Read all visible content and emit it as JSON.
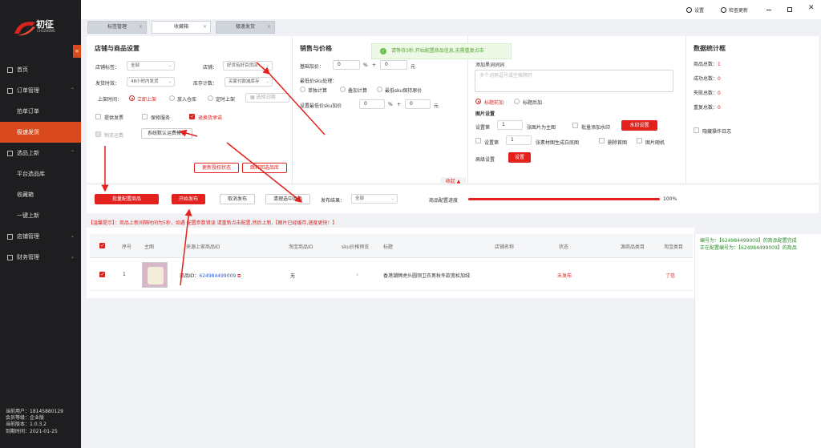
{
  "app": {
    "logo_text": "初征",
    "logo_sub": "CHUZHENG"
  },
  "topbar": {
    "settings": "设置",
    "check_update": "检查更新"
  },
  "sidebar": {
    "items": [
      {
        "label": "首页",
        "level": 0
      },
      {
        "label": "订单管理",
        "level": 0
      },
      {
        "label": "拍单订单",
        "level": 1
      },
      {
        "label": "极速发货",
        "level": 1,
        "active": true
      },
      {
        "label": "选品上新",
        "level": 0
      },
      {
        "label": "平台选品库",
        "level": 1
      },
      {
        "label": "收藏箱",
        "level": 1
      },
      {
        "label": "一键上新",
        "level": 1
      },
      {
        "label": "店铺管理",
        "level": 0
      },
      {
        "label": "财务管理",
        "level": 0
      }
    ],
    "user": {
      "current_user": "当前用户：18145880129",
      "member_level": "会员等级：企业版",
      "version": "当前版本：1.0.3.2",
      "expire": "到期时间：2021-01-25"
    }
  },
  "tabs": [
    {
      "label": "标签管理"
    },
    {
      "label": "收藏箱",
      "active": true
    },
    {
      "label": "极速发货"
    }
  ],
  "toast": {
    "text": "请等待3秒,开始配置商品信息,无需重复点击"
  },
  "shop_settings": {
    "title": "店铺与商品设置",
    "shop_tag_label": "店铺标签：",
    "shop_tag_value": "全部",
    "shop_label": "店铺：",
    "shop_value": "好货有好百货店",
    "ship_time_label": "发货时效：",
    "ship_time_value": "48小时内发货",
    "stock_label": "库存计数：",
    "stock_value": "买家付款减库存",
    "list_time_label": "上架时间：",
    "opt_now": "立即上架",
    "opt_warehouse": "放入仓库",
    "opt_timed": "定时上架",
    "date_placeholder": "选择日期",
    "invoice": "提供发票",
    "warranty": "保修服务",
    "return": "退换货承诺",
    "logistics": "物流运费",
    "template": "系统默认运费模板",
    "refresh_btn": "更新授权状态",
    "jump_btn": "跳转回选品库"
  },
  "price_settings": {
    "title": "销售与价格",
    "base_price_label": "基础加价：",
    "base_price_value": "0",
    "base_price_value2": "0",
    "unit": "元",
    "sku_label": "最低价sku处理：",
    "opt_single": "单独计算",
    "opt_add": "叠加计算",
    "opt_keep": "最低sku保持原价",
    "min_sku_label": "设置最低价sku加价",
    "min_sku_value": "0",
    "min_sku_value2": "0"
  },
  "title_settings": {
    "add_words_label": "添加黑词词词",
    "add_words_placeholder": "多个词用逗号或空格隔开",
    "opt_prefix": "标题前加",
    "opt_suffix": "标题后加",
    "image_title": "图片设置",
    "set_label": "设置第",
    "set_value": "1",
    "main_label": "张图片为主图",
    "watermark": "批量添加水印",
    "watermark_btn": "水印设置",
    "set_label2": "设置第",
    "set_value2": "1",
    "sku_main": "张素材图生成白底图",
    "del_first": "删除首图",
    "random_img": "图片随机",
    "advanced_label": "高级设置",
    "advanced_btn": "设置",
    "collapse": "收起"
  },
  "stats": {
    "title": "数据统计框",
    "total": "商品总数：",
    "total_v": "1",
    "success": "成功总数：",
    "success_v": "0",
    "failed": "失败总数：",
    "failed_v": "0",
    "repeat": "重复总数：",
    "repeat_v": "0",
    "hide_log": "隐藏操作日志"
  },
  "actions": {
    "batch_config": "批量配置商品",
    "start_publish": "开始发布",
    "cancel_publish": "取消发布",
    "clear_selected": "清理选中商品",
    "publish_result_label": "发布结果：",
    "publish_result_value": "全部",
    "progress_label": "商品配置进度",
    "progress_value": 1.0,
    "progress_text": "100%"
  },
  "warning": "【温馨提示】：商品上新间隔时间为5秒，如遇 配置参数错误 请重新点击配置,然后上新,【图片已经缓存,速度更快！】",
  "table": {
    "headers": [
      "序号",
      "主图",
      "来源上家商品ID",
      "淘宝商品ID",
      "sku价格预览",
      "标题",
      "店铺名称",
      "状态",
      "源商品类目",
      "淘宝类目"
    ],
    "rows": [
      {
        "index": "1",
        "source_id_prefix": "商品ID：",
        "source_id": "624984499009",
        "taobao_id": "无",
        "sku_preview": "›",
        "title": "香港潮牌虎头圆领卫衣男秋冬款宽松加绒",
        "shop": "",
        "status": "未发布",
        "source_cat": "",
        "tb_cat": "了信"
      }
    ]
  },
  "log": {
    "line1": "编号为：【624984499009】的商品配置完成",
    "line2": "正在配置编号为：【624984499009】的商品"
  },
  "colors": {
    "accent": "#e3211d",
    "sidebar": "#1e1e20",
    "active": "#d94a1e",
    "success": "#2e8b2e"
  }
}
